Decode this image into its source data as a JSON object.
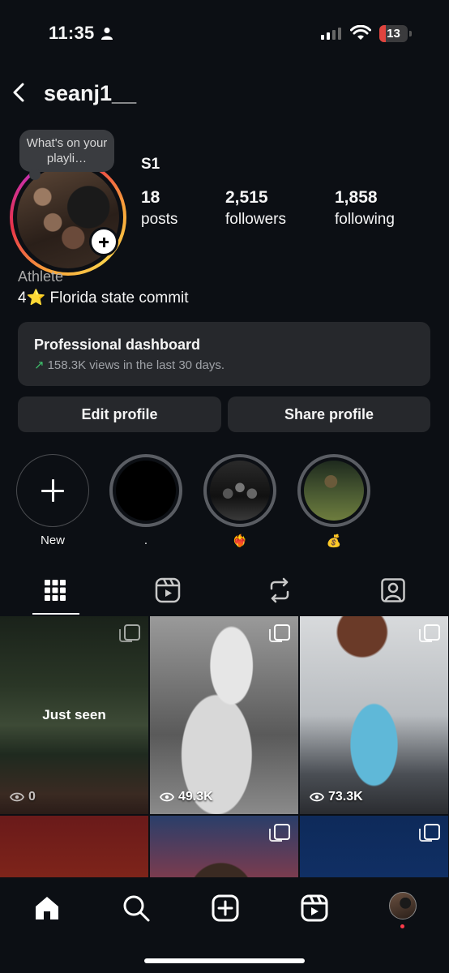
{
  "status_bar": {
    "time": "11:35",
    "battery": "13",
    "battery_color": "#e0443e"
  },
  "header": {
    "username": "seanj1__"
  },
  "profile": {
    "note": "What's on your playli…",
    "display_name": "S1",
    "stats": [
      {
        "num": "18",
        "label": "posts"
      },
      {
        "num": "2,515",
        "label": "followers"
      },
      {
        "num": "1,858",
        "label": "following"
      }
    ],
    "category": "Athlete",
    "bio": "4⭐ Florida state commit"
  },
  "dashboard": {
    "title": "Professional dashboard",
    "arrow": "↗",
    "subtitle": "158.3K views in the last 30 days."
  },
  "actions": {
    "edit": "Edit profile",
    "share": "Share profile"
  },
  "highlights": [
    {
      "label": "New",
      "icon": "plus-icon"
    },
    {
      "label": "."
    },
    {
      "label": "❤️‍🔥"
    },
    {
      "label": "💰"
    }
  ],
  "tabs": [
    "grid-icon",
    "reels-icon",
    "reposts-icon",
    "tagged-icon"
  ],
  "grid": {
    "just_seen": "Just seen",
    "posts": [
      {
        "views": "0"
      },
      {
        "views": "49.3K"
      },
      {
        "views": "73.3K"
      }
    ]
  },
  "bottom_nav": [
    "home-icon",
    "search-icon",
    "create-icon",
    "reels-icon",
    "profile-avatar"
  ],
  "colors": {
    "background": "#0c0f14",
    "card": "#26282c",
    "accent_green": "#3ec06b",
    "notification_red": "#ff3b4a"
  }
}
